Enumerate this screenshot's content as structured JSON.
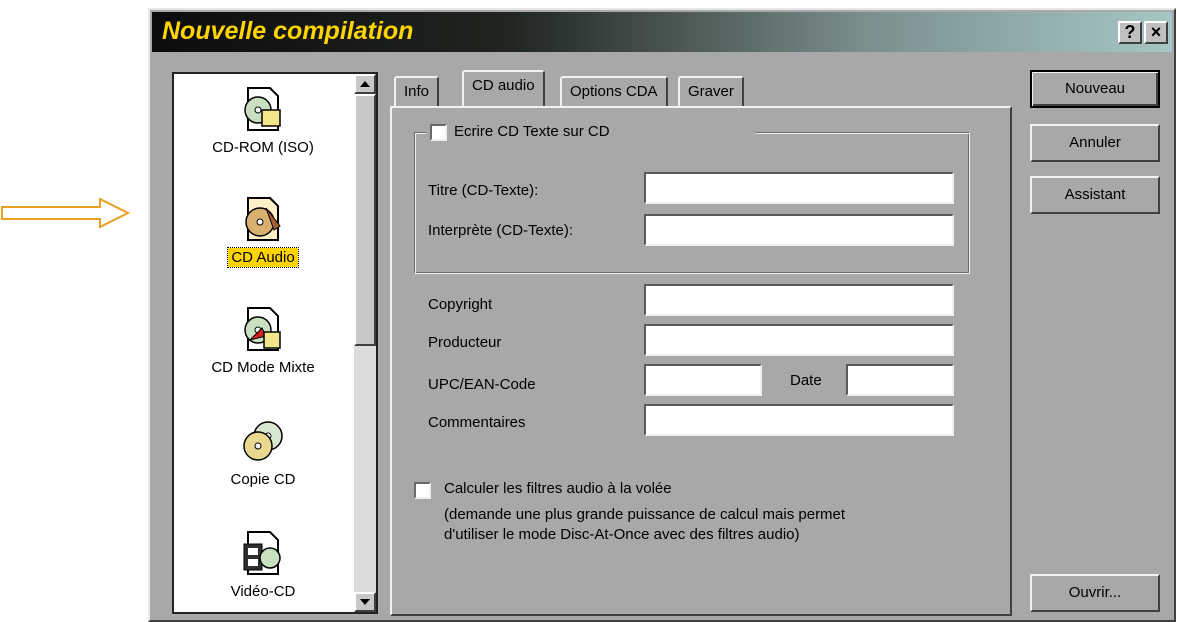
{
  "window": {
    "title": "Nouvelle compilation",
    "help_button": "?",
    "close_button": "×"
  },
  "compilation_types": [
    {
      "label": "CD-ROM (ISO)",
      "icon": "cd-rom-iso-icon"
    },
    {
      "label": "CD Audio",
      "icon": "cd-audio-icon",
      "selected": true
    },
    {
      "label": "CD Mode Mixte",
      "icon": "cd-mixed-mode-icon"
    },
    {
      "label": "Copie CD",
      "icon": "cd-copy-icon"
    },
    {
      "label": "Vidéo-CD",
      "icon": "video-cd-icon"
    }
  ],
  "tabs": [
    {
      "label": "Info"
    },
    {
      "label": "CD audio",
      "active": true
    },
    {
      "label": "Options CDA"
    },
    {
      "label": "Graver"
    }
  ],
  "cd_audio": {
    "cd_text_checkbox": "Ecrire CD Texte sur CD",
    "cd_text_checked": false,
    "title_label": "Titre (CD-Texte):",
    "title_value": "",
    "artist_label": "Interprète (CD-Texte):",
    "artist_value": "",
    "copyright_label": "Copyright",
    "copyright_value": "",
    "producer_label": "Producteur",
    "producer_value": "",
    "upc_label": "UPC/EAN-Code",
    "upc_value": "",
    "date_label": "Date",
    "date_value": "",
    "comments_label": "Commentaires",
    "comments_value": "",
    "filters_checkbox": "Calculer les filtres audio à la volée",
    "filters_checked": false,
    "filters_note_line1": "(demande une plus grande puissance de calcul mais permet",
    "filters_note_line2": "d'utiliser le mode Disc-At-Once avec des filtres audio)"
  },
  "buttons": {
    "new": "Nouveau",
    "cancel": "Annuler",
    "wizard": "Assistant",
    "open": "Ouvrir..."
  },
  "colors": {
    "title_text": "#ffd400",
    "selection_highlight": "#ffd400",
    "annotation_arrow": "#e8a020",
    "window_face": "#a8a8a8"
  }
}
